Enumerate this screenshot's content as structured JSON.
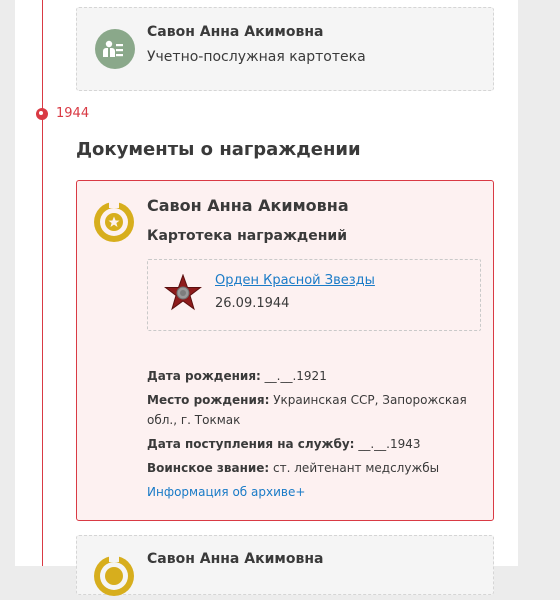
{
  "timeline": {
    "year": "1944"
  },
  "card_top": {
    "name": "Савон Анна Акимовна",
    "subtitle": "Учетно-послужная картотека",
    "icon": "person-list-icon"
  },
  "section": {
    "title": "Документы о награждении"
  },
  "card_award": {
    "name": "Савон Анна Акимовна",
    "subtitle": "Картотека награждений",
    "icon": "medal-icon",
    "award": {
      "title": "Орден Красной Звезды",
      "date": "26.09.1944",
      "icon": "red-star-order-icon"
    },
    "details": {
      "birth_date_label": "Дата рождения:",
      "birth_date_value": "__.__.1921",
      "birth_place_label": "Место рождения:",
      "birth_place_value": "Украинская ССР, Запорожская обл., г. Токмак",
      "service_date_label": "Дата поступления на службу:",
      "service_date_value": "__.__.1943",
      "rank_label": "Воинское звание:",
      "rank_value": "ст. лейтенант медслужбы"
    },
    "archive_link": "Информация об архиве+"
  },
  "card_bottom": {
    "name": "Савон Анна Акимовна",
    "icon": "medal-icon"
  },
  "colors": {
    "accent_red": "#d93a44",
    "link_blue": "#1a7bc7",
    "medal_gold": "#d7ae1d",
    "icon_green": "#8aa88a"
  }
}
